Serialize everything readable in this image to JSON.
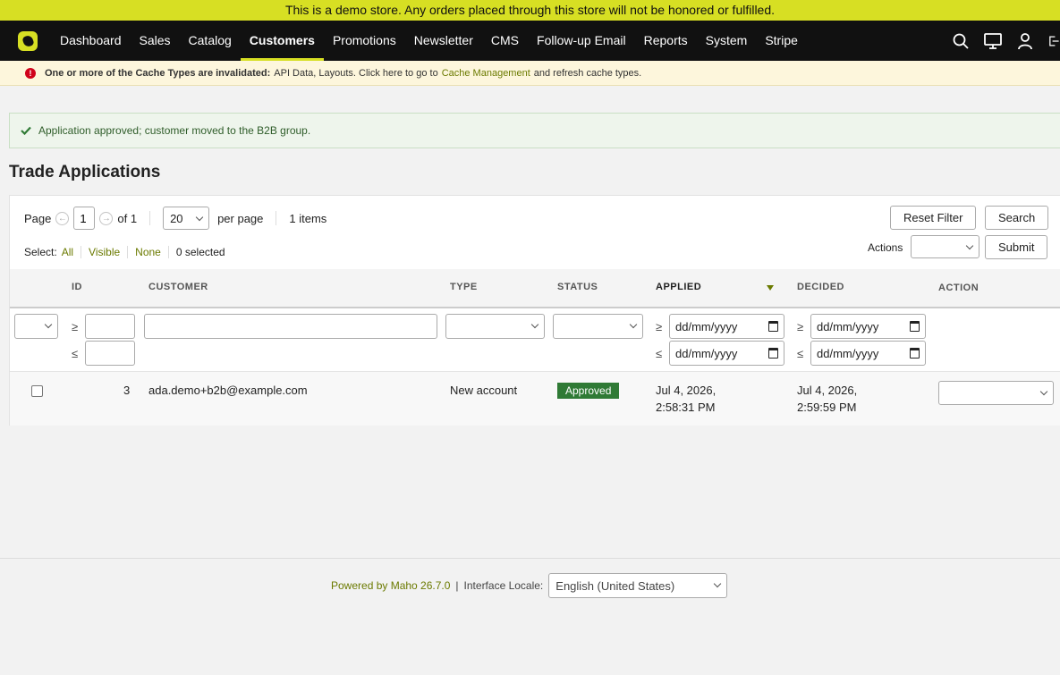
{
  "demo_banner": "This is a demo store. Any orders placed through this store will not be honored or fulfilled.",
  "nav": {
    "items": [
      {
        "label": "Dashboard",
        "name": "nav-dashboard"
      },
      {
        "label": "Sales",
        "name": "nav-sales"
      },
      {
        "label": "Catalog",
        "name": "nav-catalog"
      },
      {
        "label": "Customers",
        "name": "nav-customers",
        "active": true
      },
      {
        "label": "Promotions",
        "name": "nav-promotions"
      },
      {
        "label": "Newsletter",
        "name": "nav-newsletter"
      },
      {
        "label": "CMS",
        "name": "nav-cms"
      },
      {
        "label": "Follow-up Email",
        "name": "nav-follow-up-email"
      },
      {
        "label": "Reports",
        "name": "nav-reports"
      },
      {
        "label": "System",
        "name": "nav-system"
      },
      {
        "label": "Stripe",
        "name": "nav-stripe"
      }
    ],
    "icons": [
      "search-icon",
      "monitor-icon",
      "user-icon",
      "logout-icon"
    ],
    "accent": "#d7df23"
  },
  "cache_notice": {
    "bold": "One or more of the Cache Types are invalidated:",
    "text": "API Data, Layouts. Click here to go to",
    "link": "Cache Management",
    "tail": "and refresh cache types."
  },
  "success_message": "Application approved; customer moved to the B2B group.",
  "page_title": "Trade Applications",
  "pager": {
    "page_label": "Page",
    "page_value": "1",
    "of_label": "of 1",
    "per_page_value": "20",
    "per_page_label": "per page",
    "items_label": "1 items"
  },
  "selection": {
    "label": "Select:",
    "all": "All",
    "visible": "Visible",
    "none": "None",
    "selected": "0 selected"
  },
  "buttons": {
    "reset_filter": "Reset Filter",
    "search": "Search",
    "actions_label": "Actions",
    "submit": "Submit"
  },
  "columns": {
    "id": "ID",
    "customer": "CUSTOMER",
    "type": "TYPE",
    "status": "STATUS",
    "applied": "APPLIED",
    "decided": "DECIDED",
    "action": "ACTION"
  },
  "filters": {
    "gte": "≥",
    "lte": "≤",
    "date_placeholder": "dd/mm/yyyy"
  },
  "rows": [
    {
      "id": "3",
      "customer": "ada.demo+b2b@example.com",
      "type": "New account",
      "status": "Approved",
      "applied_line1": "Jul 4, 2026,",
      "applied_line2": "2:58:31 PM",
      "decided_line1": "Jul 4, 2026,",
      "decided_line2": "2:59:59 PM"
    }
  ],
  "status_color": "#2f7a35",
  "footer": {
    "powered": "Powered by Maho 26.7.0",
    "separator": "|",
    "locale_label": "Interface Locale:",
    "locale_value": "English (United States)"
  }
}
